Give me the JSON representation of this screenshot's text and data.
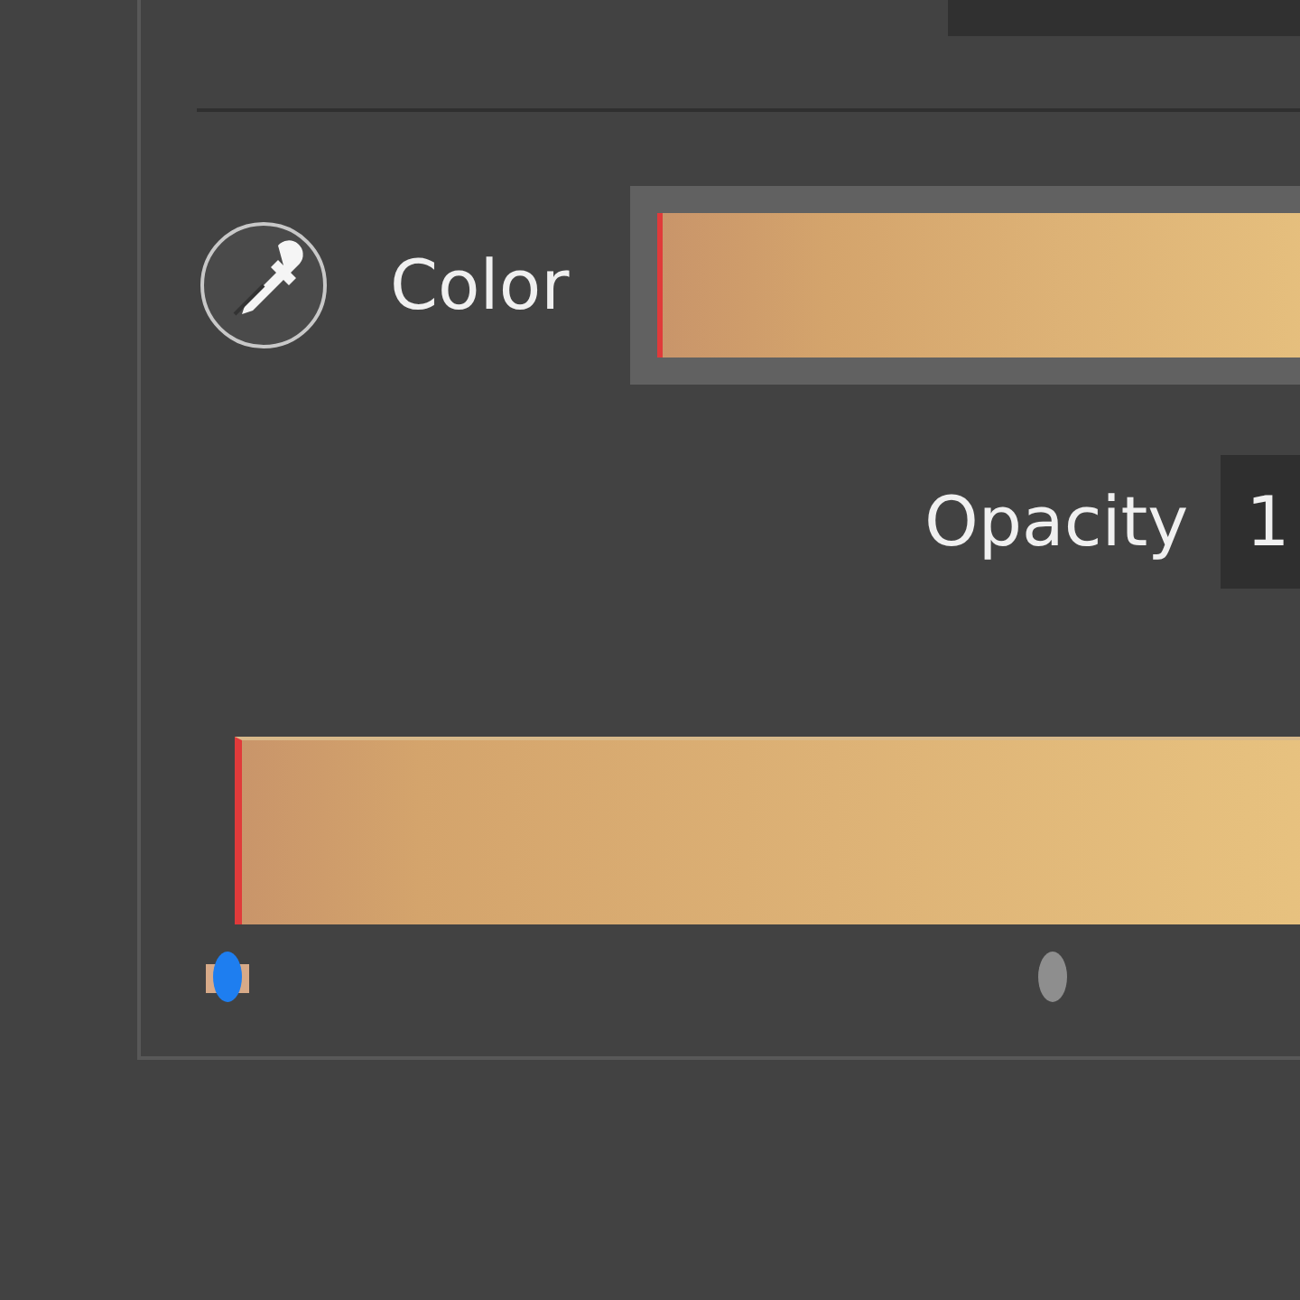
{
  "color_row": {
    "label": "Color"
  },
  "opacity": {
    "label": "Opacity",
    "value": "1"
  },
  "gradient": {
    "stops": [
      {
        "kind": "color-stop",
        "selected": true
      },
      {
        "kind": "midpoint",
        "selected": false
      }
    ]
  }
}
